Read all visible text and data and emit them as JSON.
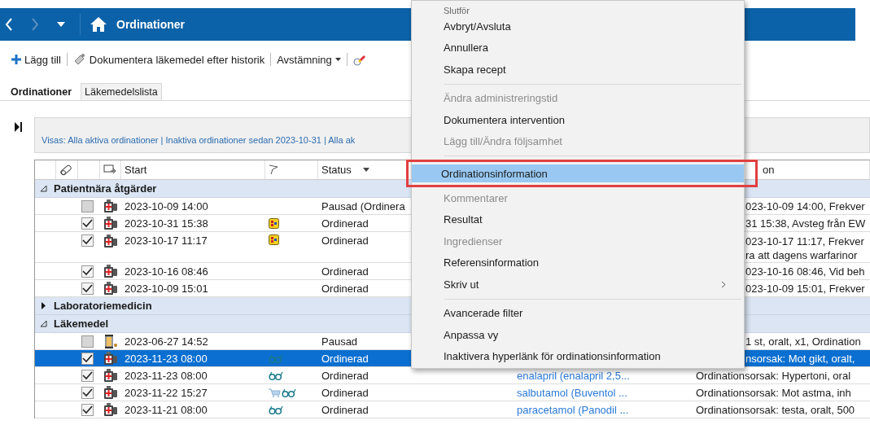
{
  "titlebar": {
    "title": "Ordinationer"
  },
  "toolbar": {
    "add": "Lägg till",
    "document": "Dokumentera läkemedel efter historik",
    "reconcile": "Avstämning"
  },
  "tabs": [
    {
      "label": "Ordinationer",
      "selected": true
    },
    {
      "label": "Läkemedelslista",
      "selected": false
    }
  ],
  "filter": {
    "text": "Visas: Alla aktiva ordinationer | Inaktiva ordinationer sedan 2023-10-31 | Alla ak"
  },
  "table": {
    "header": {
      "start": "Start",
      "status": "Status",
      "column_9": "on"
    },
    "groups": [
      {
        "label": "Patientnära åtgärder",
        "expanded": true,
        "rows": [
          {
            "kind": "order",
            "checked": false,
            "start": "2023-10-09 14:00",
            "status": "Pausad (Ordinera",
            "info": "023-10-09 14:00, Frekver",
            "selected": false
          },
          {
            "kind": "order",
            "checked": true,
            "start": "2023-10-31 15:38",
            "flags": [
              {
                "kind": "alert"
              }
            ],
            "status": "Ordinerad",
            "info": "31 15:38, Avsteg från EW",
            "selected": false
          },
          {
            "kind": "order",
            "checked": true,
            "start": "2023-10-17 11:17",
            "flags": [
              {
                "kind": "alert"
              }
            ],
            "status": "Ordinerad",
            "info": "023-10-17 11:17, Frekver\nra att dagens warfarinor",
            "selected": false
          },
          {
            "kind": "order",
            "checked": true,
            "start": "2023-10-16 08:46",
            "status": "Ordinerad",
            "info": "023-10-16 08:46, Vid beh",
            "selected": false
          },
          {
            "kind": "order",
            "checked": true,
            "start": "2023-10-09 15:01",
            "status": "Ordinerad",
            "info": "023-10-09 15:01, Frekver",
            "selected": false
          }
        ]
      },
      {
        "label": "Laboratoriemedicin",
        "expanded": false
      },
      {
        "label": "Läkemedel",
        "expanded": true,
        "rows": [
          {
            "kind": "paused",
            "checked": false,
            "start": "2023-06-27 14:52",
            "status": "Pausad",
            "info": "1 st, oralt, x1, Ordination",
            "selected": false
          },
          {
            "kind": "order",
            "checked": true,
            "start": "2023-11-23 08:00",
            "flags": [
              {
                "kind": "glasses"
              }
            ],
            "status": "Ordinerad",
            "info": "nsorsak: Mot gikt, oralt,",
            "selected": true
          },
          {
            "kind": "order",
            "checked": true,
            "start": "2023-11-23 08:00",
            "flags": [
              {
                "kind": "glasses"
              }
            ],
            "status": "Ordinerad",
            "name": "enalapril (enalapril 2,5...",
            "info": "Ordinationsorsak: Hypertoni, oral",
            "selected": false
          },
          {
            "kind": "order",
            "checked": true,
            "start": "2023-11-22 15:27",
            "flags": [
              {
                "kind": "cart"
              },
              {
                "kind": "glasses"
              }
            ],
            "status": "Ordinerad",
            "name": "salbutamol (Buventol ...",
            "info": "Ordinationsorsak: Mot astma, inh",
            "selected": false
          },
          {
            "kind": "order",
            "checked": true,
            "start": "2023-11-21 08:00",
            "flags": [
              {
                "kind": "glasses"
              }
            ],
            "status": "Ordinerad",
            "name": "paracetamol (Panodil ...",
            "info": "Ordinationsorsak: testa, oralt, 500",
            "selected": false
          }
        ]
      }
    ]
  },
  "context_menu": {
    "items": [
      {
        "kind": "item",
        "label": "Slutför",
        "disabled": false,
        "selected": false
      },
      {
        "kind": "item",
        "label": "Avbryt/Avsluta",
        "disabled": false,
        "selected": false
      },
      {
        "kind": "item",
        "label": "Annullera",
        "disabled": false,
        "selected": false
      },
      {
        "kind": "item",
        "label": "Skapa recept",
        "disabled": false,
        "selected": false
      },
      {
        "kind": "separator"
      },
      {
        "kind": "item",
        "label": "Ändra administreringstid",
        "disabled": true,
        "selected": false
      },
      {
        "kind": "item",
        "label": "Dokumentera intervention",
        "disabled": false,
        "selected": false
      },
      {
        "kind": "item",
        "label": "Lägg till/Ändra följsamhet",
        "disabled": true,
        "selected": false
      },
      {
        "kind": "separator"
      },
      {
        "kind": "item",
        "label": "Ordinationsinformation",
        "disabled": false,
        "selected": true
      },
      {
        "kind": "item",
        "label": "Kommentarer",
        "disabled": true,
        "selected": false
      },
      {
        "kind": "item",
        "label": "Resultat",
        "disabled": false,
        "selected": false
      },
      {
        "kind": "item",
        "label": "Ingredienser",
        "disabled": true,
        "selected": false
      },
      {
        "kind": "item",
        "label": "Referensinformation",
        "disabled": false,
        "selected": false
      },
      {
        "kind": "submenu",
        "label": "Skriv ut",
        "disabled": false,
        "selected": false
      },
      {
        "kind": "separator"
      },
      {
        "kind": "item",
        "label": "Avancerade filter",
        "disabled": false,
        "selected": false
      },
      {
        "kind": "item",
        "label": "Anpassa vy",
        "disabled": false,
        "selected": false
      },
      {
        "kind": "item",
        "label": "Inaktivera hyperlänk för ordinationsinformation",
        "disabled": false,
        "selected": false
      }
    ]
  }
}
